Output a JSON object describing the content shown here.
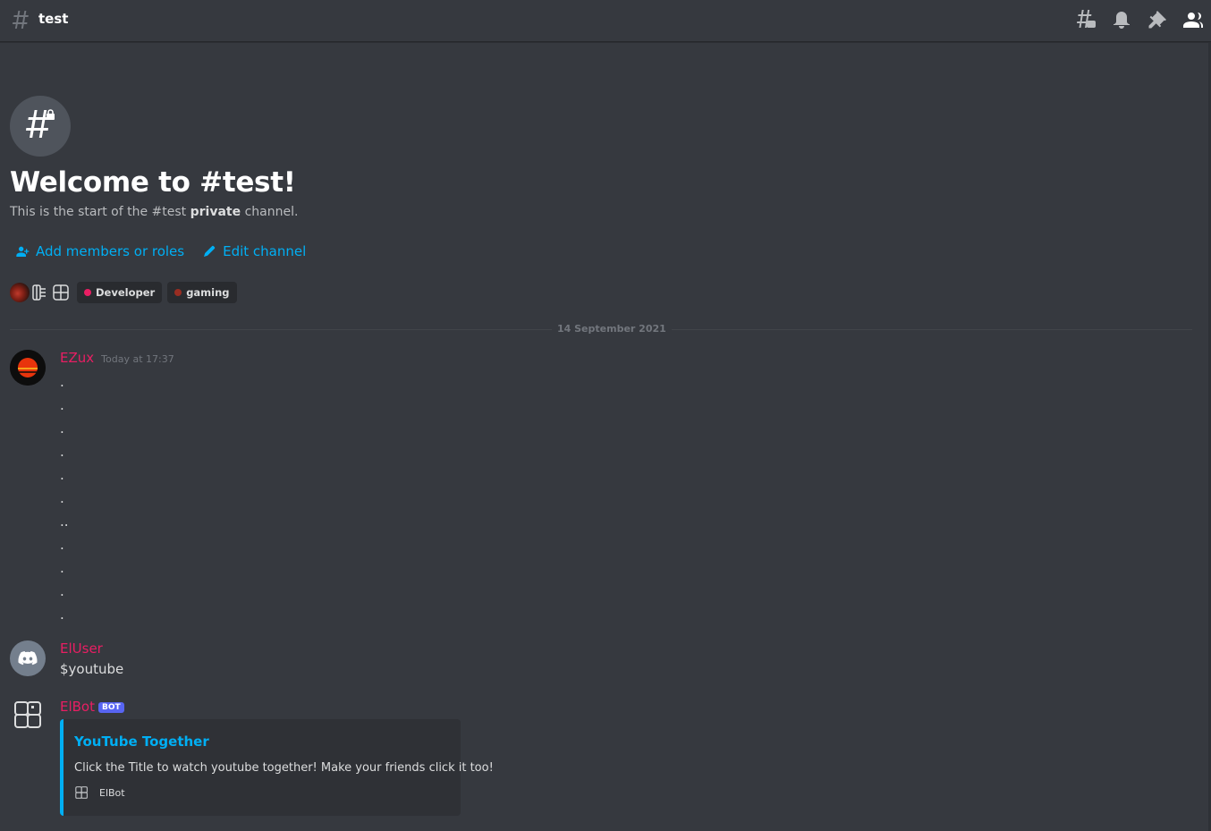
{
  "header": {
    "channel_name": "test",
    "icons": [
      "threads-icon",
      "bell-icon",
      "pin-icon",
      "members-icon"
    ]
  },
  "welcome": {
    "title": "Welcome to #test!",
    "subtitle_pre": "This is the start of the #test ",
    "subtitle_bold": "private",
    "subtitle_post": " channel."
  },
  "actions": {
    "add_members": "Add members or roles",
    "edit_channel": "Edit channel"
  },
  "roles": [
    {
      "name": "Developer",
      "color": "#e91e63"
    },
    {
      "name": "gaming",
      "color": "#992d22"
    }
  ],
  "divider": {
    "date": "14 September 2021"
  },
  "messages": [
    {
      "username": "EZux",
      "timestamp": "Today at 17:37",
      "lines": [
        ".",
        ".",
        ".",
        ".",
        ".",
        ".",
        "..",
        ".",
        ".",
        ".",
        "."
      ]
    },
    {
      "username": "ElUser",
      "text": "$youtube"
    },
    {
      "username": "ElBot",
      "bot_tag": "BOT",
      "embed": {
        "title": "YouTube Together",
        "description": "Click the Title to watch youtube together! Make your friends click it too!",
        "footer": "ElBot",
        "accent": "#00aff4"
      }
    }
  ]
}
